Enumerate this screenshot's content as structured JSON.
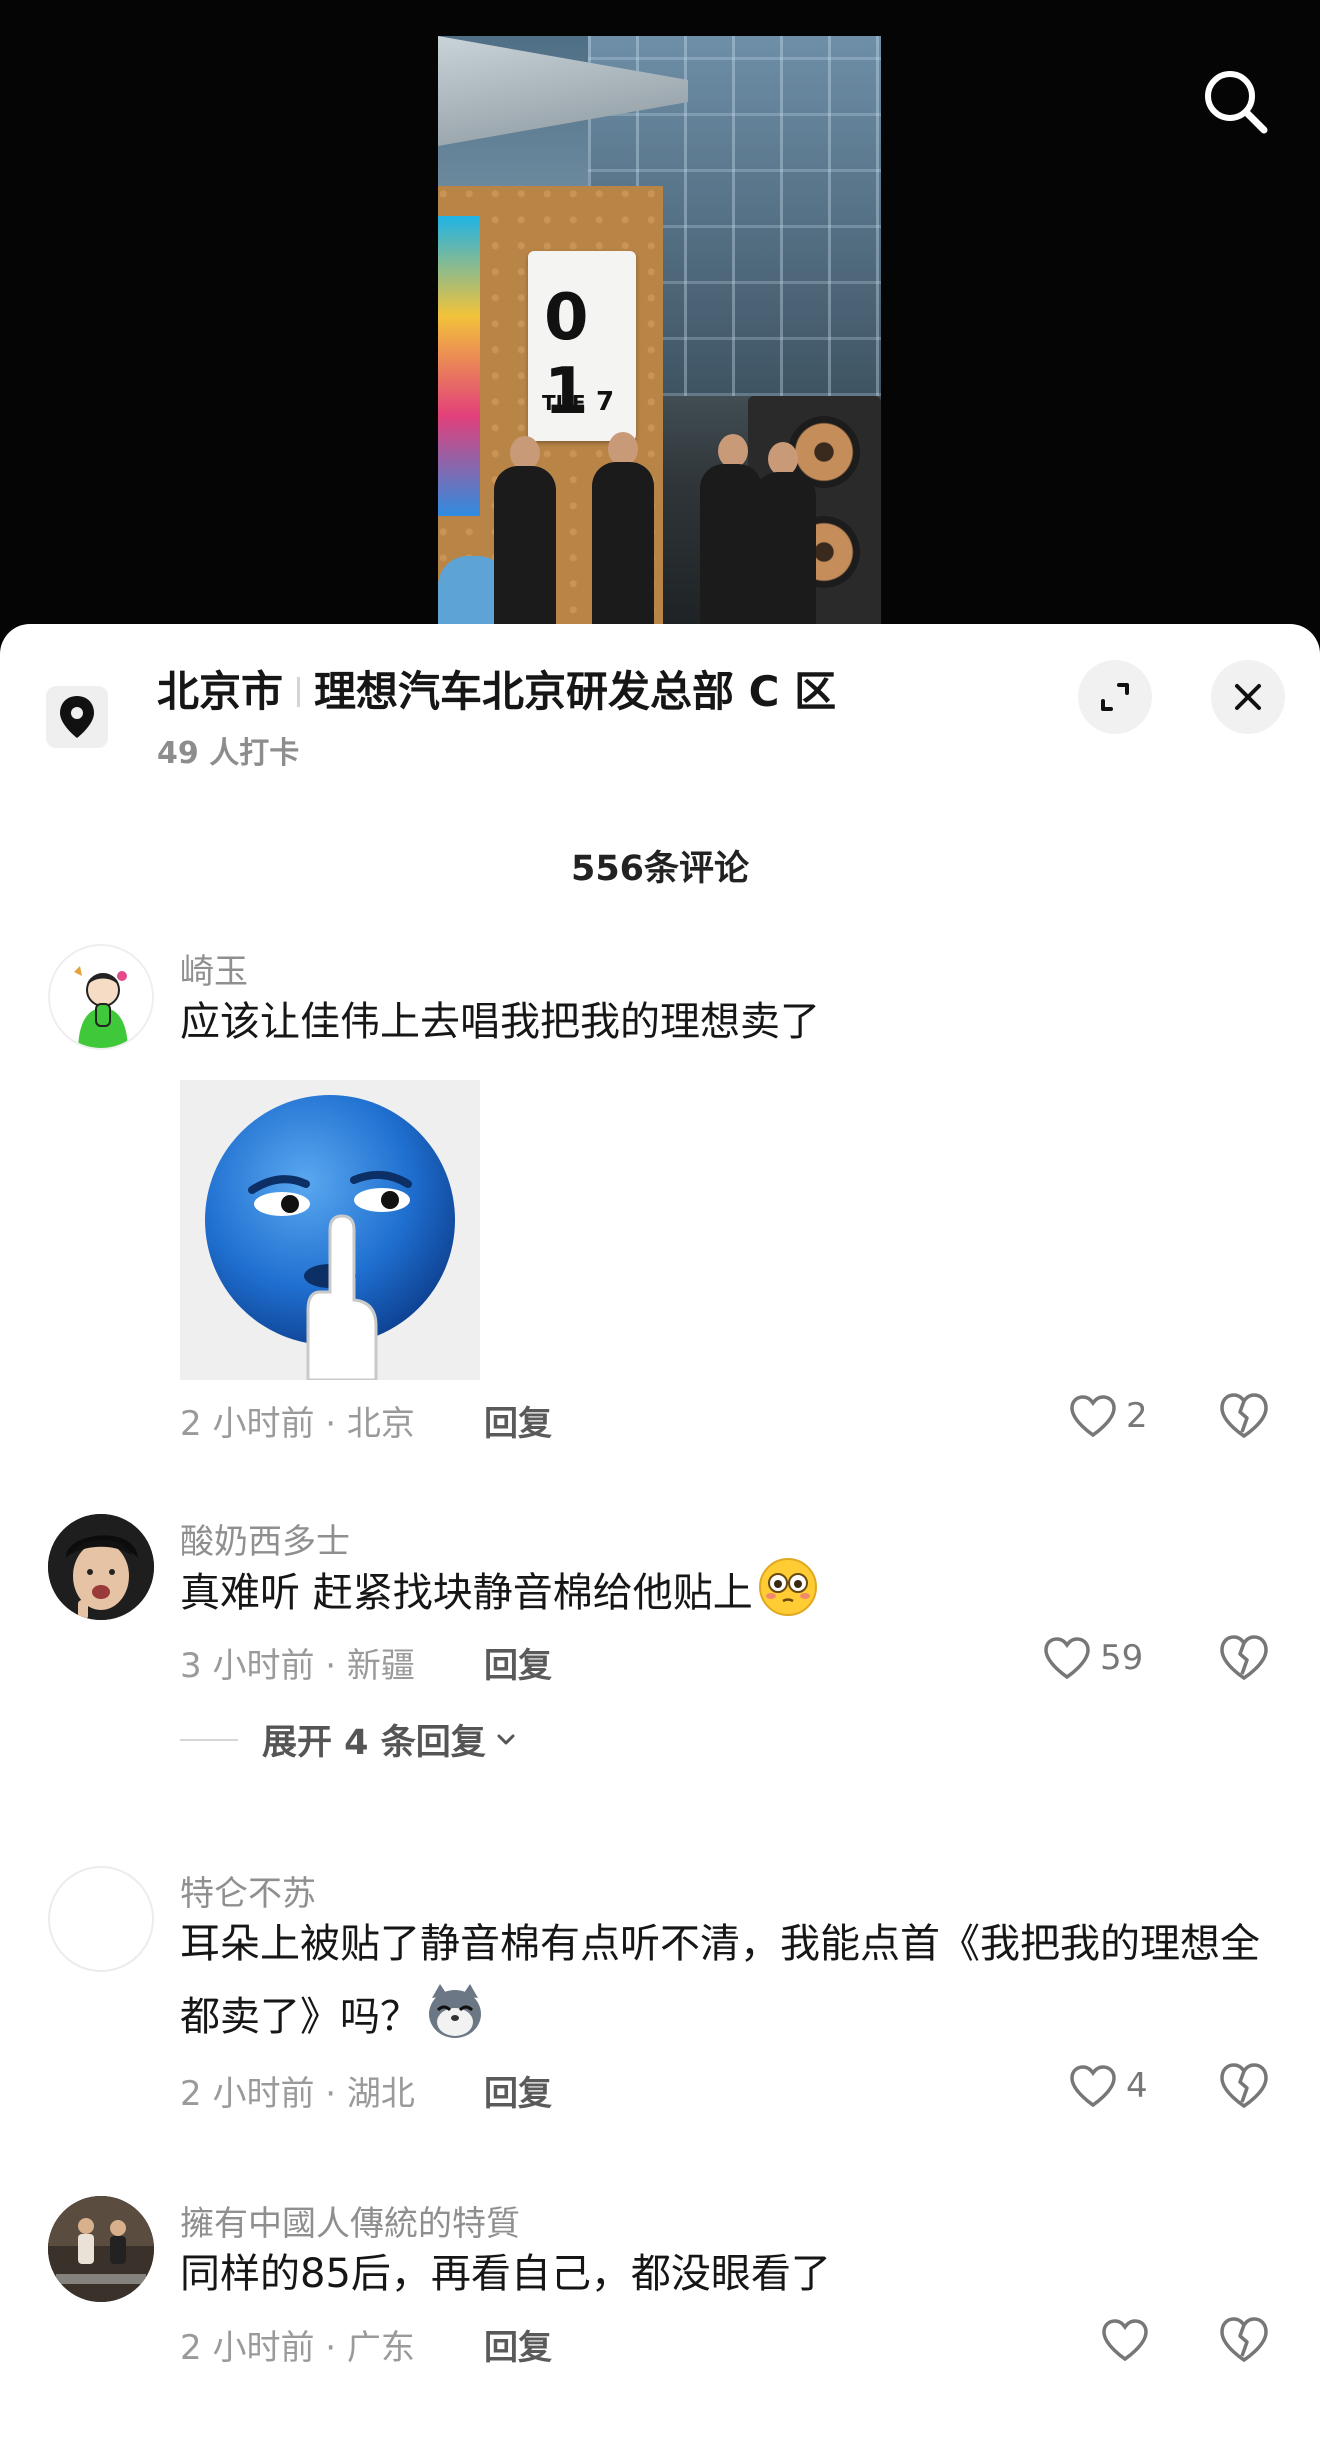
{
  "video": {
    "calendar": {
      "day_digits": "0 1",
      "weekday": "TUE",
      "date": "7"
    }
  },
  "location": {
    "city": "北京市",
    "place": "理想汽车北京研发总部 C 区",
    "checkins": "49 人打卡"
  },
  "comments_header": {
    "count_label": "556条评论"
  },
  "comments": [
    {
      "user": "崎玉",
      "text": "应该让佳伟上去唱我把我的理想卖了",
      "time_location": "2 小时前 · 北京",
      "reply_label": "回复",
      "likes": "2"
    },
    {
      "user": "酸奶西多士",
      "text": "真难听 赶紧找块静音棉给他贴上",
      "time_location": "3 小时前 · 新疆",
      "reply_label": "回复",
      "likes": "59",
      "expand_replies": "展开 4 条回复"
    },
    {
      "user": "特仑不苏",
      "text": "耳朵上被贴了静音棉有点听不清，我能点首《我把我的理想全都卖了》吗？",
      "time_location": "2 小时前 · 湖北",
      "reply_label": "回复",
      "likes": "4"
    },
    {
      "user": "擁有中國人傳統的特質",
      "text": "同样的85后，再看自己，都没眼看了",
      "time_location": "2 小时前 · 广东",
      "reply_label": "回复",
      "likes": ""
    }
  ],
  "colors": {
    "sheet_bg": "#ffffff",
    "primary_text": "#161616",
    "secondary_text": "#8f8f8f",
    "button_bg": "#f1f1f1"
  },
  "icons": [
    "search-icon",
    "location-pin-icon",
    "expand-icon",
    "close-icon",
    "heart-icon",
    "broken-heart-icon",
    "chevron-down-icon"
  ]
}
